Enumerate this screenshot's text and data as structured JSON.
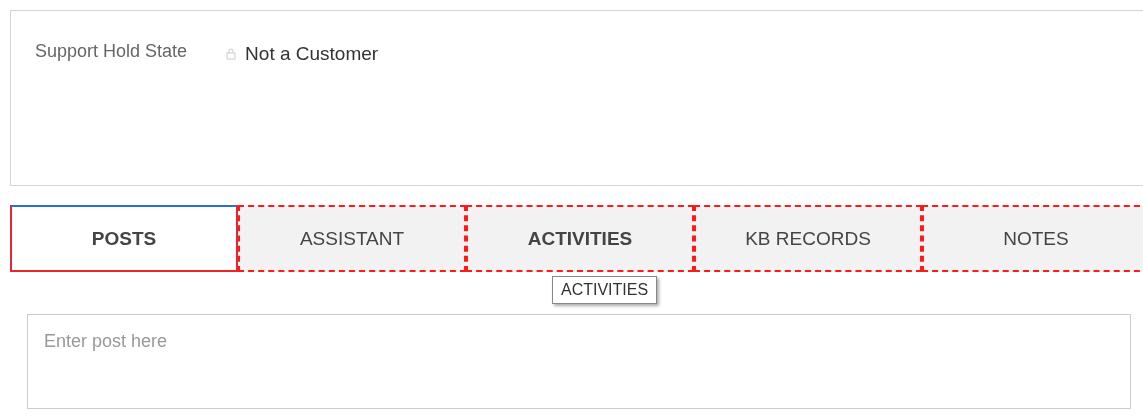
{
  "field": {
    "label": "Support Hold State",
    "value": "Not a Customer"
  },
  "tabs": [
    {
      "label": "POSTS",
      "selected": true,
      "hovered": false
    },
    {
      "label": "ASSISTANT",
      "selected": false,
      "hovered": false
    },
    {
      "label": "ACTIVITIES",
      "selected": false,
      "hovered": true
    },
    {
      "label": "KB RECORDS",
      "selected": false,
      "hovered": false
    },
    {
      "label": "NOTES",
      "selected": false,
      "hovered": false
    }
  ],
  "tooltip": "ACTIVITIES",
  "post": {
    "placeholder": "Enter post here"
  }
}
